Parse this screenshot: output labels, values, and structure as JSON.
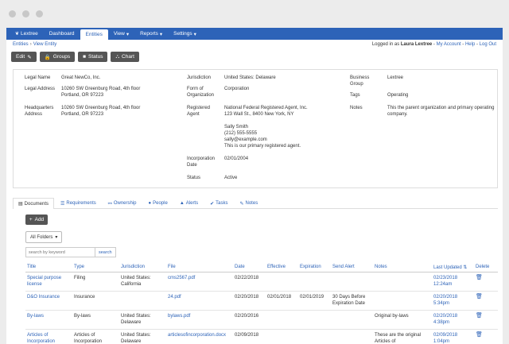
{
  "nav": {
    "brand": "Lextree",
    "items": [
      {
        "label": "Dashboard",
        "arrow": ""
      },
      {
        "label": "Entities",
        "arrow": ""
      },
      {
        "label": "View",
        "arrow": "▾"
      },
      {
        "label": "Reports",
        "arrow": "▾"
      },
      {
        "label": "Settings",
        "arrow": "▾"
      }
    ]
  },
  "breadcrumb": [
    "Entities",
    "View Entity"
  ],
  "login": {
    "prefix": "Logged in as",
    "user": "Laura Lextree",
    "links": [
      "My Account",
      "Help",
      "Log Out"
    ]
  },
  "actions": [
    {
      "label": "Edit",
      "icon": "✎"
    },
    {
      "label": "Groups",
      "icon": "🔒"
    },
    {
      "label": "Status",
      "icon": "■"
    },
    {
      "label": "Chart",
      "icon": "⛬"
    }
  ],
  "entity": {
    "legal_name_label": "Legal Name",
    "legal_name": "Great NewCo, Inc.",
    "legal_address_label": "Legal Address",
    "legal_address_1": "10260 SW Greenburg Road, 4th floor",
    "legal_address_2": "Portland, OR 97223",
    "hq_label_1": "Headquarters",
    "hq_label_2": "Address",
    "hq_address_1": "10260 SW Greenburg Road, 4th floor",
    "hq_address_2": "Portland, OR 97223",
    "jurisdiction_label": "Jurisdiction",
    "jurisdiction": "United States: Delaware",
    "form_label_1": "Form of",
    "form_label_2": "Organization",
    "form": "Corporation",
    "agent_label_1": "Registered",
    "agent_label_2": "Agent",
    "agent_1": "National Federal Registered Agent, Inc.",
    "agent_2": "123 Wall St., 8400 New York, NY",
    "agent_contact": "Sally Smith",
    "agent_phone": "(212) 555-5555",
    "agent_email": "sally@example.com",
    "agent_note": "This is our primary registered agent.",
    "inc_label_1": "Incorporation",
    "inc_label_2": "Date",
    "inc_date": "02/01/2004",
    "status_label": "Status",
    "status": "Active",
    "bg_label_1": "Business",
    "bg_label_2": "Group",
    "business_group": "Lextree",
    "tags_label": "Tags",
    "tags": "Operating",
    "notes_label": "Notes",
    "notes_1": "This the parent organization and primary operating",
    "notes_2": "company."
  },
  "tabs": [
    {
      "label": "Documents",
      "icon": "▤"
    },
    {
      "label": "Requirements",
      "icon": "☰"
    },
    {
      "label": "Ownership",
      "icon": "⚯"
    },
    {
      "label": "People",
      "icon": "●"
    },
    {
      "label": "Alerts",
      "icon": "▲"
    },
    {
      "label": "Tasks",
      "icon": "✔"
    },
    {
      "label": "Notes",
      "icon": "✎"
    }
  ],
  "documents": {
    "add_label": "Add",
    "folders_label": "All Folders",
    "search_placeholder": "search by keyword",
    "search_button": "search",
    "columns": [
      "Title",
      "Type",
      "Jurisdiction",
      "File",
      "Date",
      "Effective",
      "Expiration",
      "Send Alert",
      "Notes",
      "Last Updated",
      "Delete"
    ],
    "rows": [
      {
        "title": "Special purpose license",
        "type": "Filing",
        "jurisdiction": "United States: California",
        "file": "cms2567.pdf",
        "date": "02/22/2018",
        "effective": "",
        "expiration": "",
        "send_alert": "",
        "notes": "",
        "updated": "02/23/2018 12:24am"
      },
      {
        "title": "D&O Insurance",
        "type": "Insurance",
        "jurisdiction": "",
        "file": "24.pdf",
        "date": "02/20/2018",
        "effective": "02/01/2018",
        "expiration": "02/01/2019",
        "send_alert": "30 Days Before Expiration Date",
        "notes": "",
        "updated": "02/20/2018 5:34pm"
      },
      {
        "title": "By-laws",
        "type": "By-laws",
        "jurisdiction": "United States: Delaware",
        "file": "bylaws.pdf",
        "date": "02/20/2016",
        "effective": "",
        "expiration": "",
        "send_alert": "",
        "notes": "Original by-laws",
        "updated": "02/20/2018 4:38pm"
      },
      {
        "title": "Articles of Incorporation",
        "type": "Articles of Incorporation",
        "jurisdiction": "United States: Delaware",
        "file": "articlesofincorporation.docx",
        "date": "02/09/2018",
        "effective": "",
        "expiration": "",
        "send_alert": "",
        "notes": "These are the original Articles of",
        "updated": "02/09/2018 1:04pm"
      }
    ]
  }
}
